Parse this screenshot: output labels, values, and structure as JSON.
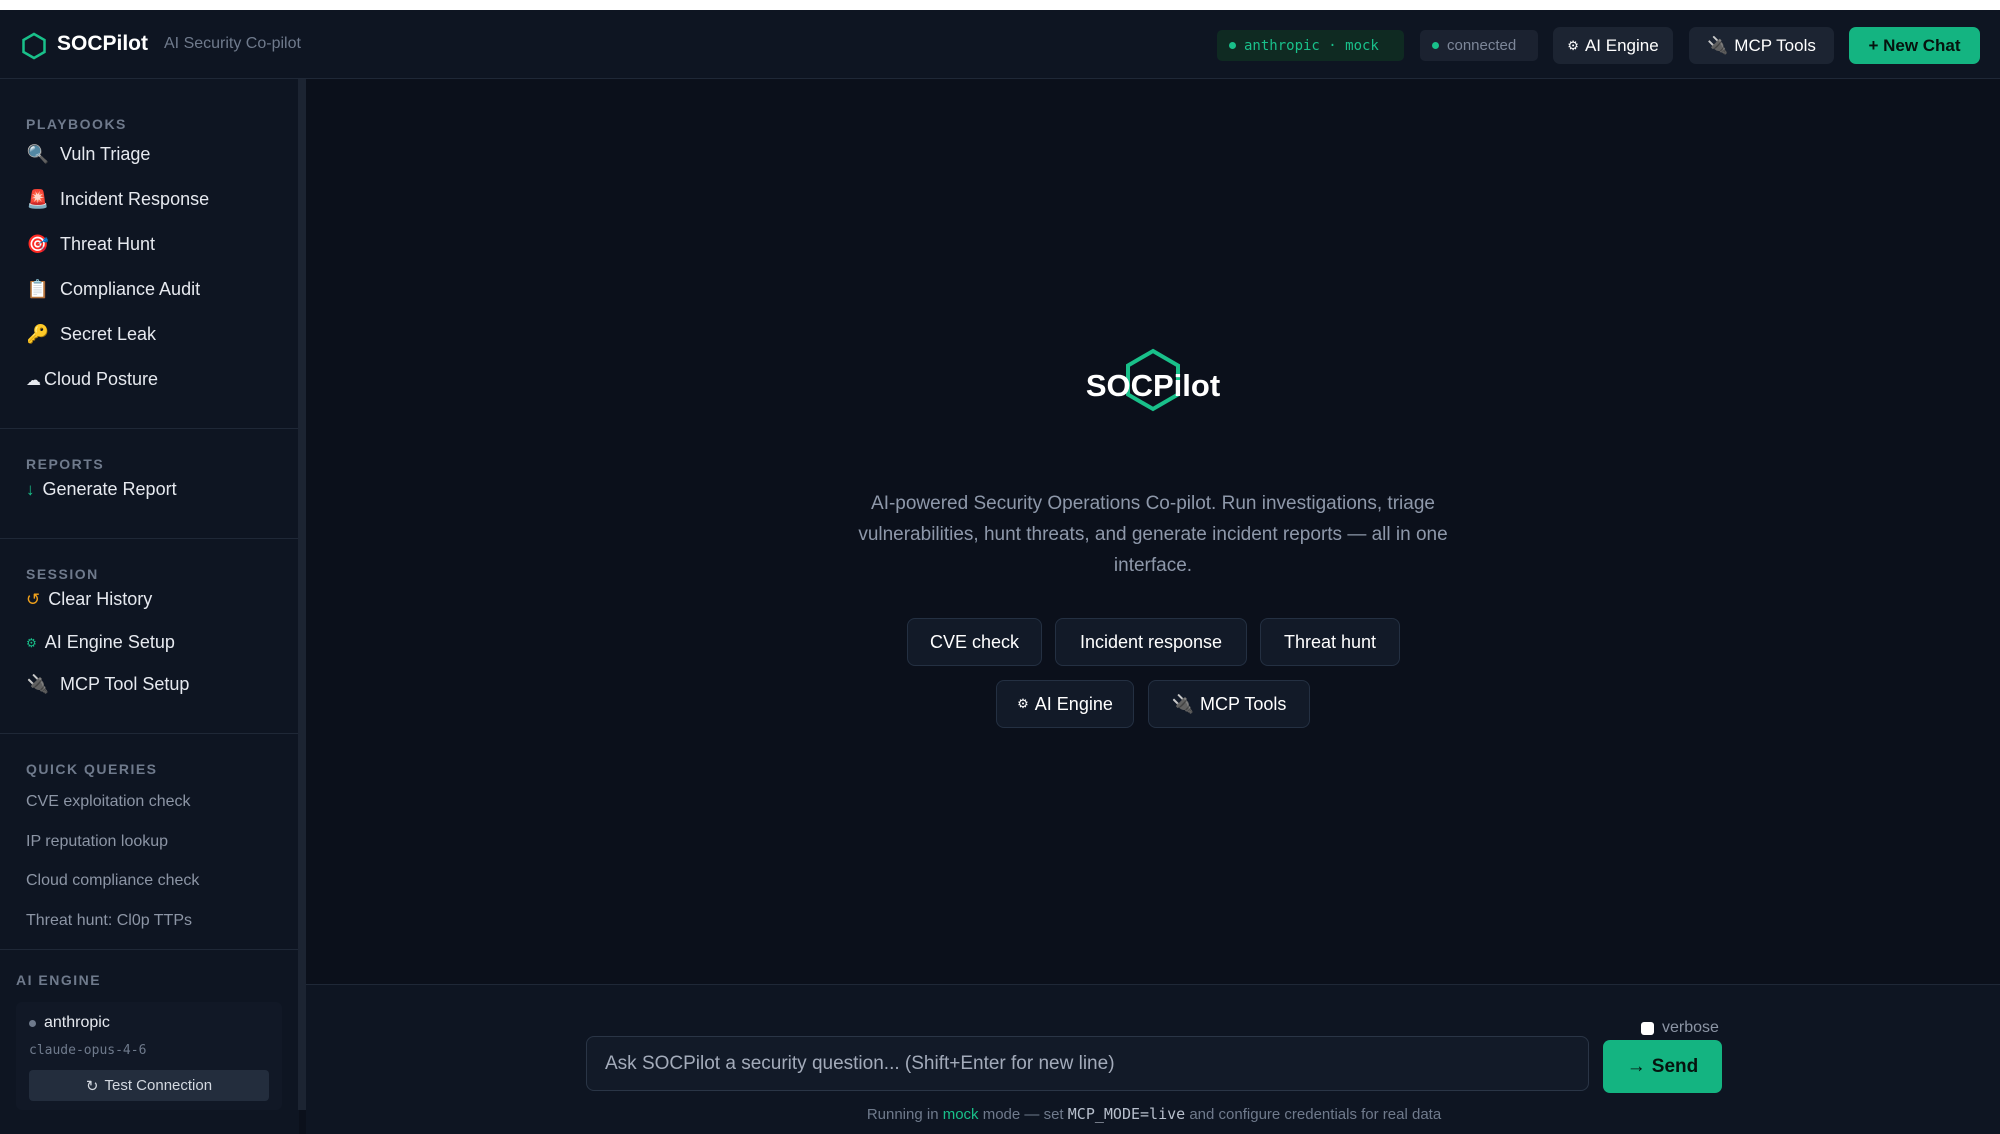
{
  "header": {
    "brand": "SOCPilot",
    "tagline": "AI Security Co-pilot",
    "provider_pill": "anthropic · mock",
    "status_pill": "connected",
    "ai_engine_btn": "AI Engine",
    "mcp_tools_btn": "MCP Tools",
    "new_chat_btn": "+ New Chat"
  },
  "sidebar": {
    "playbooks_heading": "PLAYBOOKS",
    "playbooks": [
      {
        "label": "Vuln Triage",
        "icon": "🔍"
      },
      {
        "label": "Incident Response",
        "icon": "🚨"
      },
      {
        "label": "Threat Hunt",
        "icon": "🎯"
      },
      {
        "label": "Compliance Audit",
        "icon": "📋"
      },
      {
        "label": "Secret Leak",
        "icon": "🔑"
      },
      {
        "label": "Cloud Posture",
        "icon": "☁"
      }
    ],
    "reports_heading": "REPORTS",
    "generate_report": "Generate Report",
    "session_heading": "SESSION",
    "clear_history": "Clear History",
    "ai_engine_setup": "AI Engine Setup",
    "mcp_tool_setup": "MCP Tool Setup",
    "quick_heading": "QUICK QUERIES",
    "quick_queries": [
      "CVE exploitation check",
      "IP reputation lookup",
      "Cloud compliance check",
      "Threat hunt: Cl0p TTPs"
    ],
    "engine_heading": "AI ENGINE",
    "engine_name": "anthropic",
    "engine_model": "claude-opus-4-6",
    "test_connection": "Test Connection"
  },
  "main": {
    "title": "SOCPilot",
    "description": "AI-powered Security Operations Co-pilot. Run investigations, triage vulnerabilities, hunt threats, and generate incident reports — all in one interface.",
    "chips": [
      "CVE check",
      "Incident response",
      "Threat hunt",
      "AI Engine",
      "MCP Tools"
    ]
  },
  "composer": {
    "verbose_label": "verbose",
    "placeholder": "Ask SOCPilot a security question... (Shift+Enter for new line)",
    "send_label": "Send",
    "note_prefix": "Running in",
    "note_mode": "mock",
    "note_middle": "mode — set",
    "note_code": "MCP_MODE=live",
    "note_suffix": "and configure credentials for real data"
  },
  "colors": {
    "accent": "#14b481",
    "background": "#0b101b",
    "panel": "#0e1522"
  }
}
